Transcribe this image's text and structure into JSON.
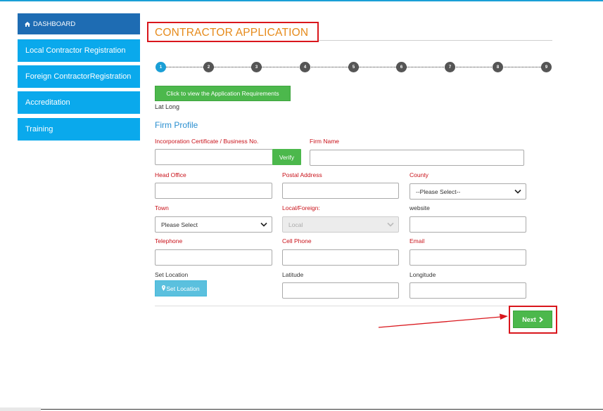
{
  "sidebar": {
    "items": [
      {
        "label": "DASHBOARD",
        "icon": "home-icon"
      },
      {
        "label": "Local Contractor Registration"
      },
      {
        "label": "Foreign ContractorRegistration"
      },
      {
        "label": "Accreditation"
      },
      {
        "label": "Training"
      }
    ]
  },
  "page": {
    "title": "CONTRACTOR APPLICATION"
  },
  "stepper": {
    "steps": [
      "1",
      "2",
      "3",
      "4",
      "5",
      "6",
      "7",
      "8",
      "9"
    ],
    "active": "1"
  },
  "requirements_button": "Click to view the Application Requirements",
  "lat_long_text": "Lat Long",
  "section_title": "Firm Profile",
  "form": {
    "incorporation_label": "Incorporation Certificate / Business No.",
    "incorporation_value": "",
    "verify_label": "Verify",
    "firm_name_label": "Firm Name",
    "head_office_label": "Head Office",
    "postal_address_label": "Postal Address",
    "county_label": "County",
    "county_value": "--Please Select--",
    "town_label": "Town",
    "town_value": "Please Select",
    "local_foreign_label": "Local/Foreign:",
    "local_foreign_value": "Local",
    "website_label": "website",
    "telephone_label": "Telephone",
    "cell_phone_label": "Cell Phone",
    "email_label": "Email",
    "set_location_label": "Set Location",
    "set_location_button": "Set Location",
    "latitude_label": "Latitude",
    "longitude_label": "Longitude"
  },
  "next_button": "Next",
  "colors": {
    "sidebar_blue": "#0aa9ec",
    "dashboard_blue": "#1e6cb3",
    "title_orange": "#e68a1a",
    "required_red": "#c9121a",
    "button_green": "#4cb84c",
    "annotation_red": "#d9161c"
  }
}
